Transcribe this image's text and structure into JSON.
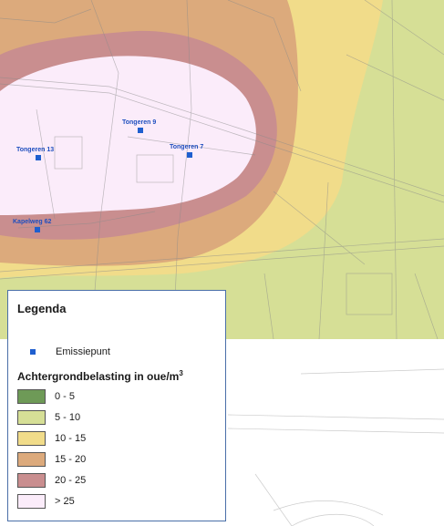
{
  "points": [
    {
      "id": "tongeren-9",
      "label": "Tongeren 9"
    },
    {
      "id": "tongeren-13",
      "label": "Tongeren 13"
    },
    {
      "id": "tongeren-7",
      "label": "Tongeren 7"
    },
    {
      "id": "kapelweg-62",
      "label": "Kapelweg 62"
    }
  ],
  "legend": {
    "title": "Legenda",
    "emission_label": "Emissiepunt",
    "background_title": "Achtergrondbelasting in oue/m",
    "background_unit_sup": "3",
    "classes": [
      {
        "label": "0 - 5",
        "color": "#6e9a57"
      },
      {
        "label": "5 - 10",
        "color": "#d6df96"
      },
      {
        "label": "10 - 15",
        "color": "#f1dc8a"
      },
      {
        "label": "15 - 20",
        "color": "#dcaa7c"
      },
      {
        "label": "20 - 25",
        "color": "#c98e8f"
      },
      {
        "label": "> 25",
        "color": "#fbecfa"
      }
    ]
  },
  "colors": {
    "emission_point": "#1f5fcf",
    "legend_border": "#4a6fa8"
  }
}
